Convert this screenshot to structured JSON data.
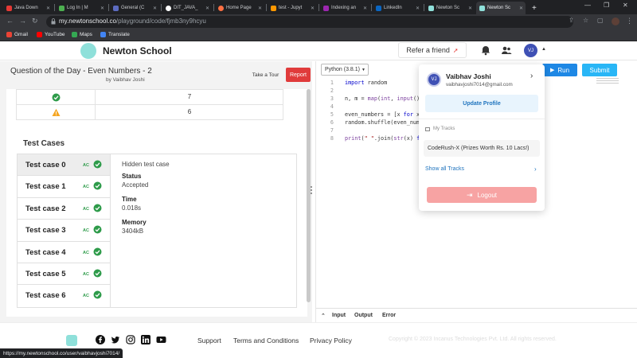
{
  "browser": {
    "tabs": [
      {
        "title": "Java Down",
        "color": "#e53935"
      },
      {
        "title": "Log In | M",
        "color": "#4caf50"
      },
      {
        "title": "General (C",
        "color": "#5c6bc0"
      },
      {
        "title": "DIT_JAVA_",
        "color": "#ffffff"
      },
      {
        "title": "Home Page",
        "color": "#ff7043"
      },
      {
        "title": "test - Jupyt",
        "color": "#ff9800"
      },
      {
        "title": "Indexing an",
        "color": "#9c27b0"
      },
      {
        "title": "LinkedIn",
        "color": "#0a66c2"
      },
      {
        "title": "Newton Sc",
        "color": "#8fe0da"
      },
      {
        "title": "Newton Sc",
        "color": "#8fe0da"
      }
    ],
    "new_tab": "+",
    "url_host": "my.newtonschool.co",
    "url_path": "/playground/code/fjmb3ny9hcyu",
    "bookmarks": [
      {
        "label": "Gmail",
        "color": "#ea4335"
      },
      {
        "label": "YouTube",
        "color": "#ff0000"
      },
      {
        "label": "Maps",
        "color": "#34a853"
      },
      {
        "label": "Translate",
        "color": "#4285f4"
      }
    ],
    "status_url": "https://my.newtonschool.co/user/vaibhavjoshi7014/"
  },
  "header": {
    "logo_text": "Newton School",
    "refer_label": "Refer a friend",
    "avatar_initials": "VJ"
  },
  "question": {
    "title": "Question of the Day - Even Numbers - 2",
    "author": "by Vaibhav Joshi",
    "take_tour": "Take a Tour",
    "report": "Report"
  },
  "results_rows": [
    {
      "status": "pass",
      "value": "7"
    },
    {
      "status": "warn",
      "value": "6"
    }
  ],
  "test_cases": {
    "heading": "Test Cases",
    "items": [
      {
        "label": "Test case 0",
        "badge": "AC"
      },
      {
        "label": "Test case 1",
        "badge": "AC"
      },
      {
        "label": "Test case 2",
        "badge": "AC"
      },
      {
        "label": "Test case 3",
        "badge": "AC"
      },
      {
        "label": "Test case 4",
        "badge": "AC"
      },
      {
        "label": "Test case 5",
        "badge": "AC"
      },
      {
        "label": "Test case 6",
        "badge": "AC"
      }
    ],
    "detail": {
      "hidden": "Hidden test case",
      "status_label": "Status",
      "status_value": "Accepted",
      "time_label": "Time",
      "time_value": "0.018s",
      "memory_label": "Memory",
      "memory_value": "3404kB"
    }
  },
  "editor": {
    "language": "Python (3.8.1)",
    "run_label": "Run",
    "submit_label": "Submit",
    "lines": [
      {
        "n": "1",
        "code": "import random"
      },
      {
        "n": "2",
        "code": ""
      },
      {
        "n": "3",
        "code": "n, m = map(int, input()"
      },
      {
        "n": "4",
        "code": ""
      },
      {
        "n": "5",
        "code": "even_numbers = [x for x"
      },
      {
        "n": "6",
        "code": "random.shuffle(even_numb"
      },
      {
        "n": "7",
        "code": ""
      },
      {
        "n": "8",
        "code": "print(\" \".join(str(x) fo"
      }
    ],
    "io_tabs": [
      "Input",
      "Output",
      "Error"
    ]
  },
  "profile_menu": {
    "initials": "VJ",
    "name": "Vaibhav Joshi",
    "email": "vaibhavjoshi7014@gmail.com",
    "update_profile": "Update Profile",
    "my_tracks": "My Tracks",
    "track": "CodeRush-X (Prizes Worth Rs. 10 Lacs!)",
    "show_all": "Show all Tracks",
    "logout": "Logout"
  },
  "footer": {
    "links": [
      "Support",
      "Terms and Conditions",
      "Privacy Policy"
    ],
    "copyright": "Copyright © 2023 Incanus Technologies Pvt. Ltd. All rights reserved."
  },
  "colors": {
    "accent": "#1e88e5",
    "report": "#e03b3b",
    "success": "#2e9b4a",
    "logout": "#f7a3a3"
  }
}
